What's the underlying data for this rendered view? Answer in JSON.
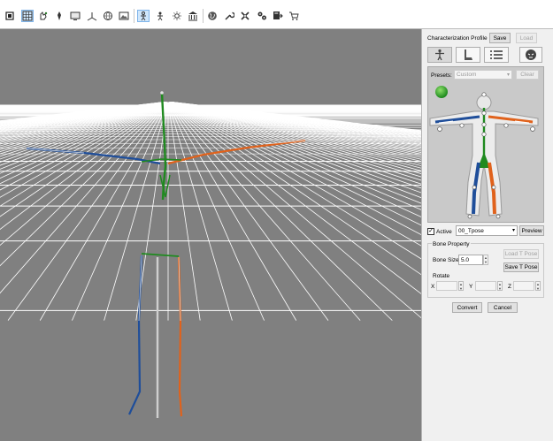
{
  "toolbar": {
    "icons": [
      "select-icon",
      "grid-icon",
      "rotate-hand-icon",
      "pen-icon",
      "monitor-icon",
      "axis-icon",
      "globe-icon",
      "image-icon",
      "bone-active-icon",
      "bone-mirror-icon",
      "sun-icon",
      "building-icon",
      "world-icon",
      "wrench-icon",
      "tools-icon",
      "gears-icon",
      "export-icon",
      "cart-icon"
    ]
  },
  "panel": {
    "profile_label": "Characterization Profile",
    "save_label": "Save",
    "load_label": "Load",
    "presets_label": "Presets:",
    "presets_value": "Custom",
    "clear_label": "Clear",
    "active_label": "Active",
    "active_checked": true,
    "pose_value": "00_Tpose",
    "preview_label": "Preview",
    "bone_property_label": "Bone Property",
    "bone_size_label": "Bone Size",
    "bone_size_value": "5.0",
    "load_tpose_label": "Load T Pose",
    "save_tpose_label": "Save T Pose",
    "rotate_label": "Rotate",
    "x_label": "X",
    "y_label": "Y",
    "z_label": "Z",
    "convert_label": "Convert",
    "cancel_label": "Cancel"
  },
  "colors": {
    "viewport_bg": "#808080",
    "grid_line": "#ffffff",
    "bone_green": "#1f8a1f",
    "bone_blue": "#1f4e9a",
    "bone_orange": "#e0621c",
    "bone_gray": "#cfcfcf"
  }
}
